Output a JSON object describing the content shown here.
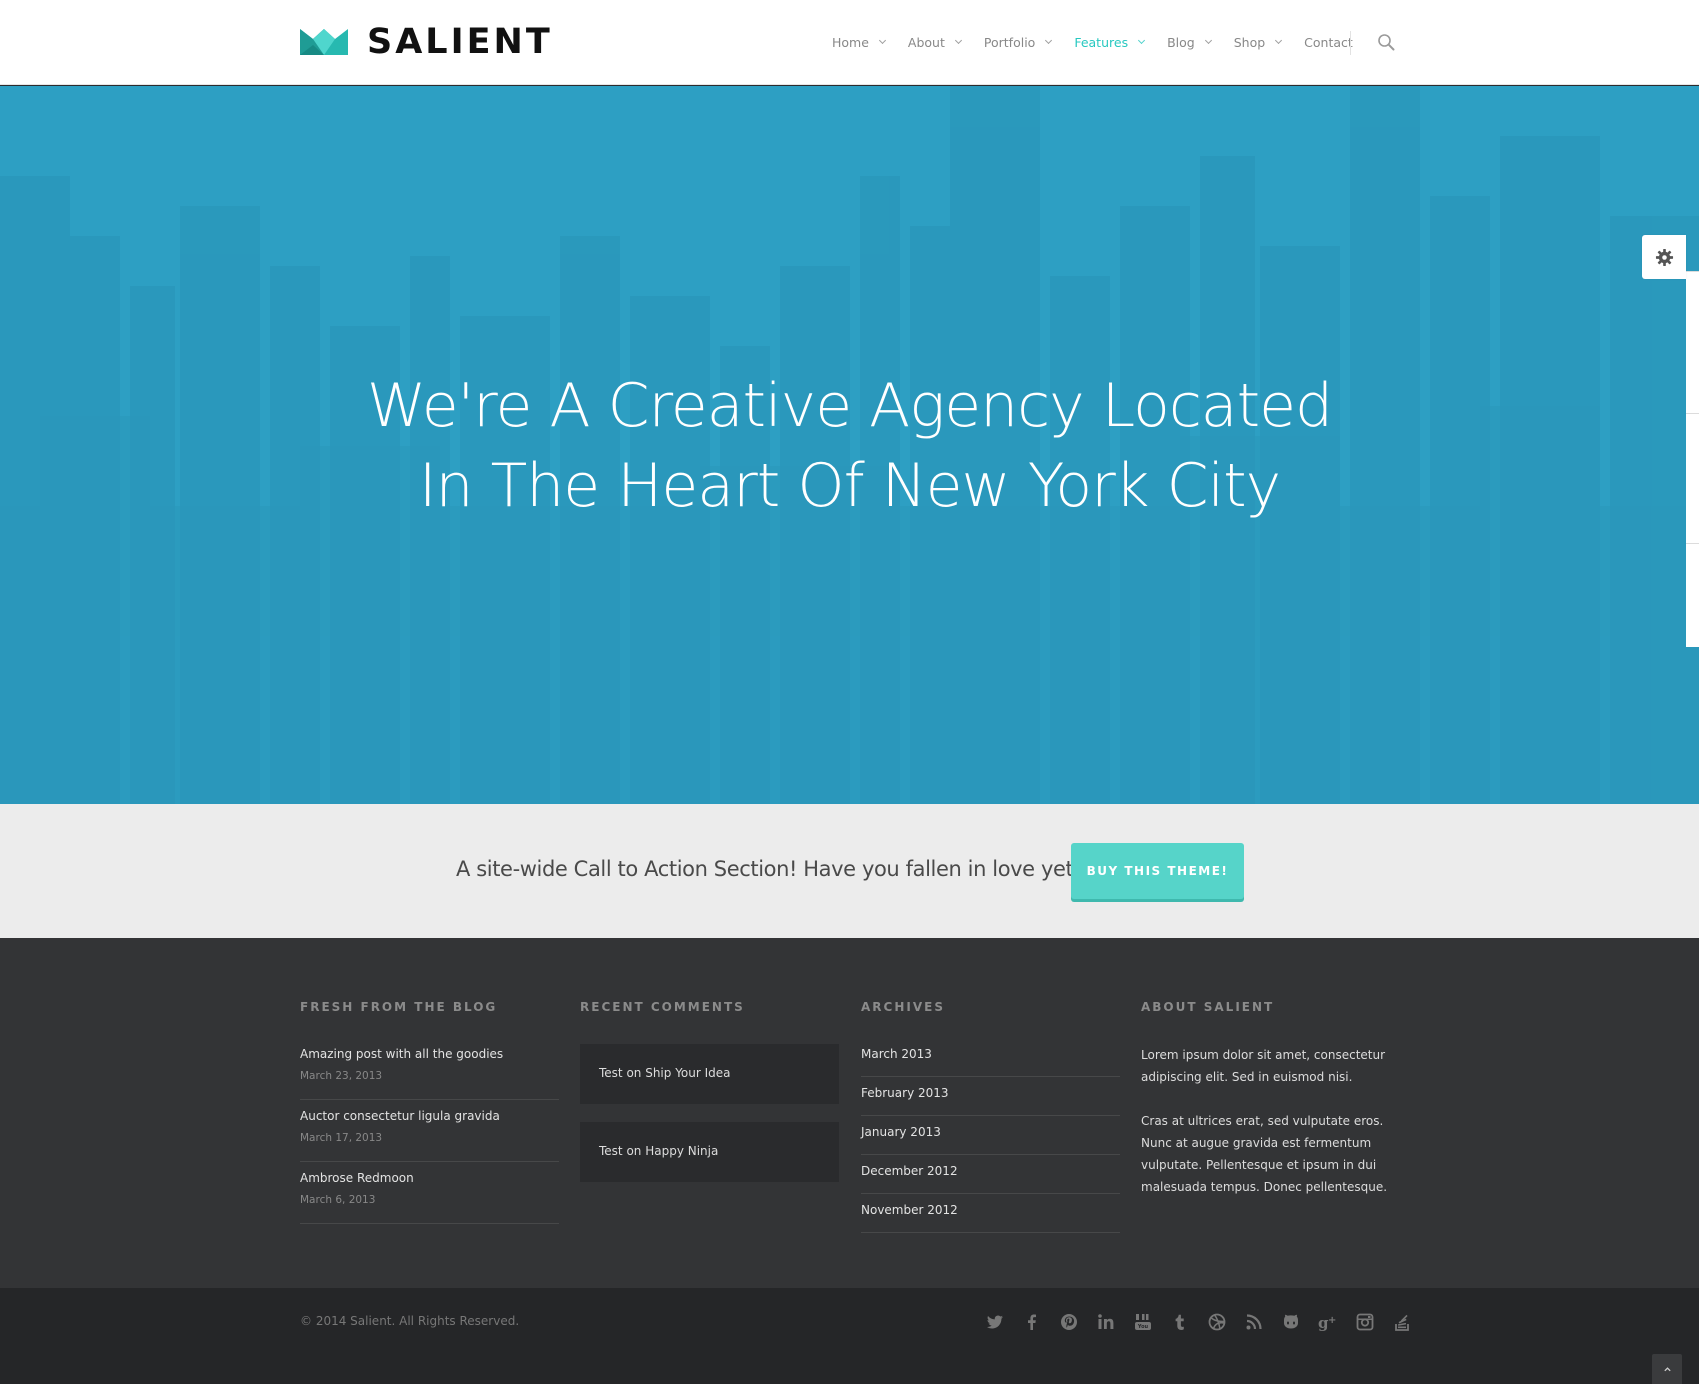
{
  "brand": {
    "name": "SALIENT",
    "accent": "#27c8c0"
  },
  "nav": {
    "items": [
      {
        "label": "Home",
        "has_dropdown": true,
        "active": false
      },
      {
        "label": "About",
        "has_dropdown": true,
        "active": false
      },
      {
        "label": "Portfolio",
        "has_dropdown": true,
        "active": false
      },
      {
        "label": "Features",
        "has_dropdown": true,
        "active": true
      },
      {
        "label": "Blog",
        "has_dropdown": true,
        "active": false
      },
      {
        "label": "Shop",
        "has_dropdown": true,
        "active": false
      },
      {
        "label": "Contact",
        "has_dropdown": false,
        "active": false
      }
    ],
    "search_icon": "search-icon"
  },
  "hero": {
    "line1": "We're A Creative Agency Located",
    "line2": "In The Heart Of New York City",
    "bg_color": "#2d9fc3"
  },
  "cta": {
    "text": "A site-wide Call to Action Section! Have you fallen in love yet?",
    "button_label": "BUY THIS THEME!",
    "button_color": "#56d4c9"
  },
  "footer": {
    "blog": {
      "title": "FRESH FROM THE BLOG",
      "posts": [
        {
          "title": "Amazing post with all the goodies",
          "date": "March 23, 2013"
        },
        {
          "title": "Auctor consectetur ligula gravida",
          "date": "March 17, 2013"
        },
        {
          "title": "Ambrose Redmoon",
          "date": "March 6, 2013"
        }
      ]
    },
    "comments": {
      "title": "RECENT COMMENTS",
      "items": [
        {
          "text": "Test on Ship Your Idea"
        },
        {
          "text": "Test on Happy Ninja"
        }
      ]
    },
    "archives": {
      "title": "ARCHIVES",
      "items": [
        "March 2013",
        "February 2013",
        "January 2013",
        "December 2012",
        "November 2012"
      ]
    },
    "about": {
      "title": "ABOUT SALIENT",
      "p1": "Lorem ipsum dolor sit amet, consectetur adipiscing elit. Sed in euismod nisi.",
      "p2": "Cras at ultrices erat, sed vulputate eros. Nunc at augue gravida est fermentum vulputate. Pellentesque et ipsum in dui malesuada tempus. Donec pellentesque."
    }
  },
  "bottom": {
    "copyright": "© 2014 Salient. All Rights Reserved.",
    "social": [
      "twitter-icon",
      "facebook-icon",
      "pinterest-icon",
      "linkedin-icon",
      "youtube-icon",
      "tumblr-icon",
      "dribbble-icon",
      "rss-icon",
      "github-icon",
      "google-plus-icon",
      "instagram-icon",
      "stackexchange-icon"
    ]
  }
}
